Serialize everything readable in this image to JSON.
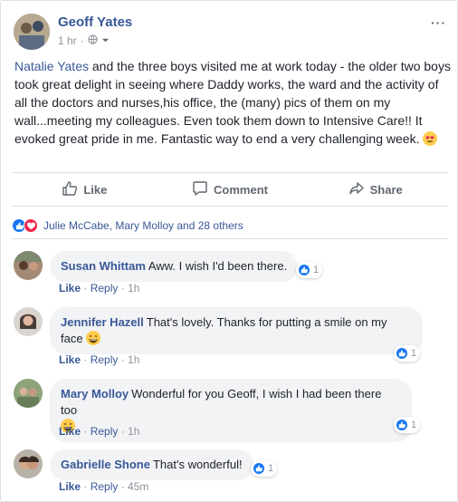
{
  "post": {
    "author": "Geoff Yates",
    "time": "1 hr",
    "dot": "·",
    "text_link": "Natalie Yates",
    "text_rest": " and the three boys visited me at work today - the older two boys took great delight in seeing where Daddy works, the ward and the activity of all the doctors and nurses,his office, the (many) pics of them on my wall...meeting my colleagues. Even took them down to Intensive Care!! It evoked great pride in me. Fantastic way to end a very challenging week. ",
    "more": "···"
  },
  "actions": {
    "like": "Like",
    "comment": "Comment",
    "share": "Share"
  },
  "reactions": {
    "summary": "Julie McCabe, Mary Molloy and 28 others"
  },
  "comments": [
    {
      "name": "Susan Whittam",
      "text": "Aww. I wish I'd been there.",
      "like": "Like",
      "reply": "Reply",
      "time": "1h",
      "reacts": "1"
    },
    {
      "name": "Jennifer Hazell",
      "text": "That's lovely. Thanks for putting a smile on my face",
      "like": "Like",
      "reply": "Reply",
      "time": "1h",
      "reacts": "1"
    },
    {
      "name": "Mary Molloy",
      "text": "Wonderful for you Geoff, I wish I had been there too",
      "like": "Like",
      "reply": "Reply",
      "time": "1h",
      "reacts": "1"
    },
    {
      "name": "Gabrielle Shone",
      "text": "That's wonderful!",
      "like": "Like",
      "reply": "Reply",
      "time": "45m",
      "reacts": "1"
    }
  ],
  "colors": {
    "link": "#385898",
    "like_blue": "#1877f2",
    "love_red": "#f0284a",
    "bubble": "#f2f3f5"
  }
}
